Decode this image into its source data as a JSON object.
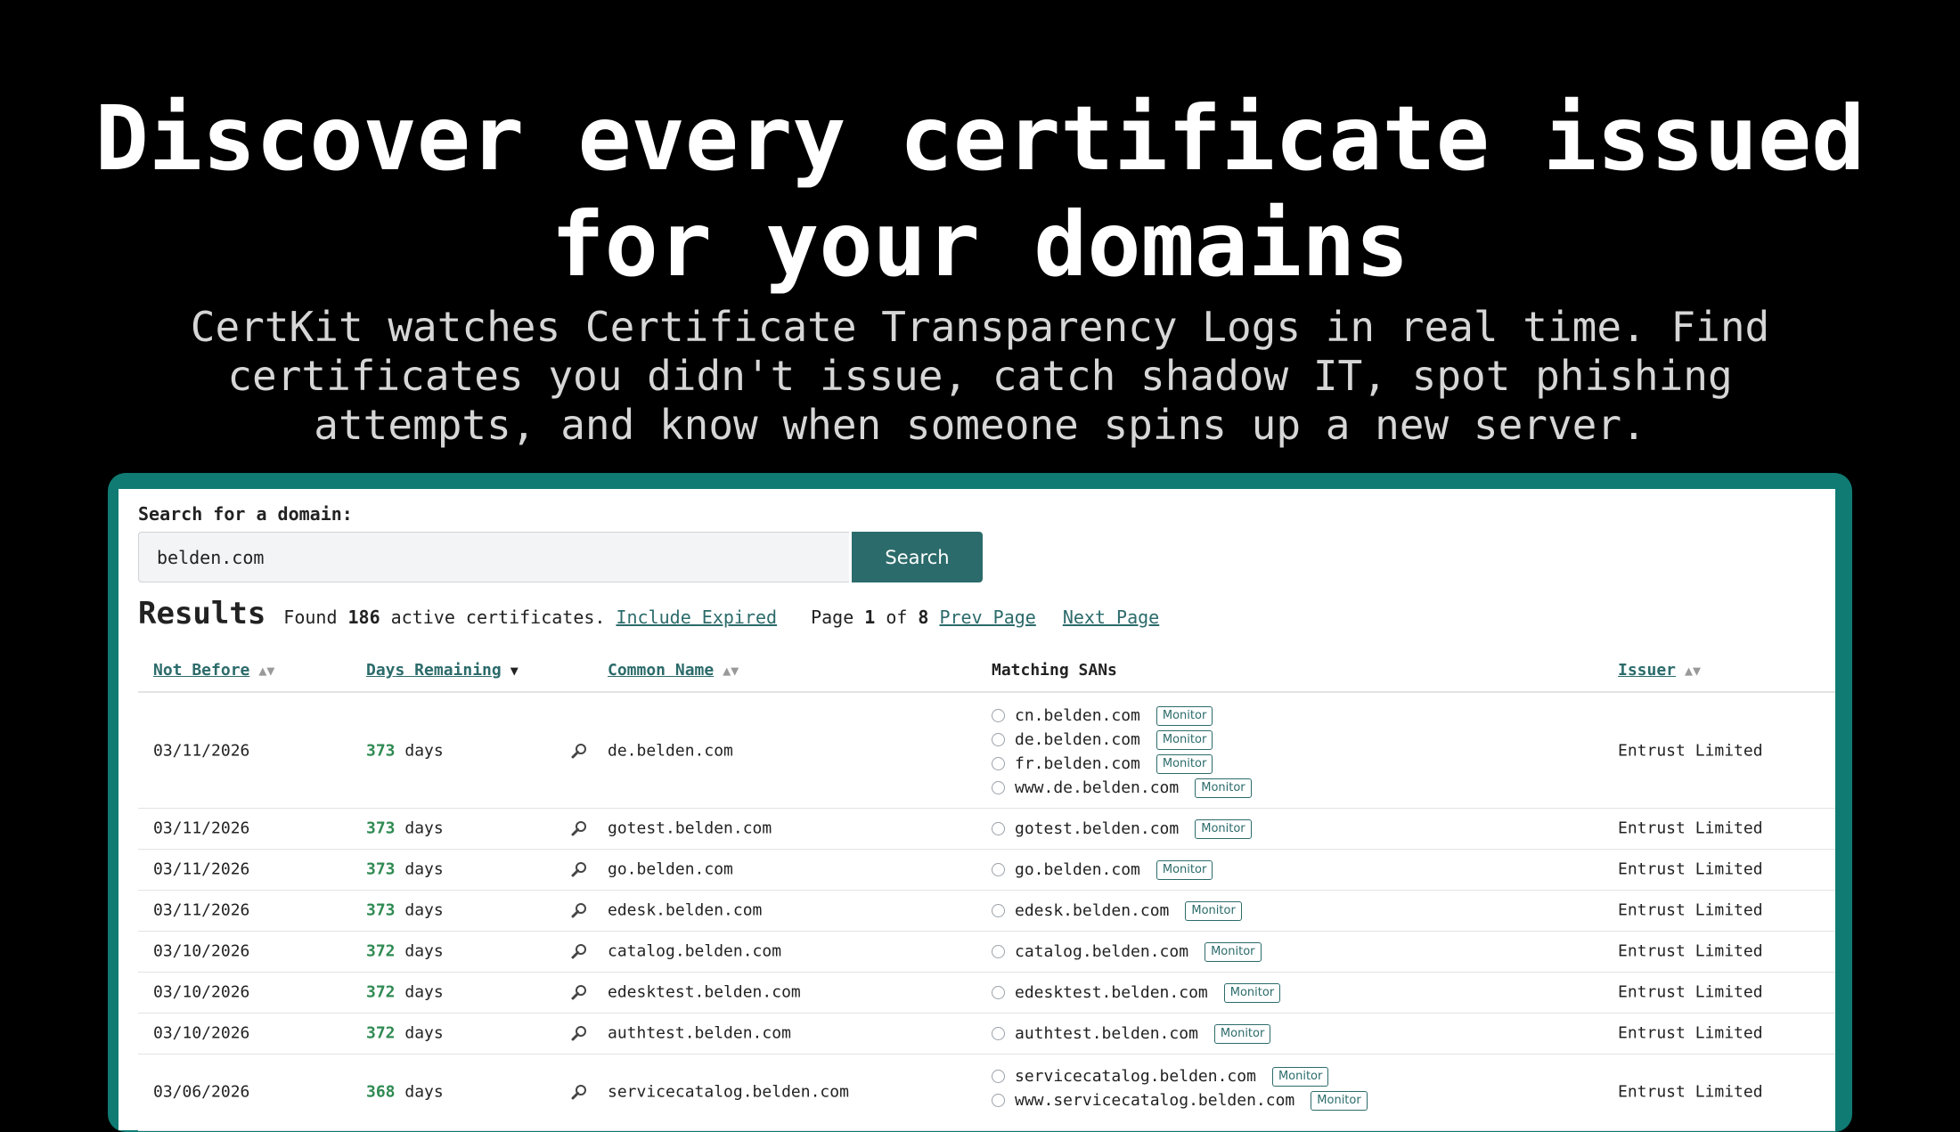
{
  "hero": {
    "title_line1": "Discover every certificate issued",
    "title_line2": "for your domains",
    "sub_line1": "CertKit watches Certificate Transparency Logs in real time. Find",
    "sub_line2": "certificates you didn't issue, catch shadow IT, spot phishing",
    "sub_line3": "attempts, and know when someone spins up a new server."
  },
  "search": {
    "label": "Search for a domain:",
    "value": "belden.com",
    "button": "Search"
  },
  "results": {
    "title": "Results",
    "found_prefix": "Found",
    "count": "186",
    "found_suffix": "active certificates.",
    "include_expired": "Include Expired",
    "page_label": "Page",
    "page": "1",
    "of_label": "of",
    "total_pages": "8",
    "prev": "Prev Page",
    "next": "Next Page"
  },
  "table": {
    "headers": {
      "not_before": "Not Before",
      "days_remaining": "Days Remaining",
      "common_name": "Common Name",
      "matching_sans": "Matching SANs",
      "issuer": "Issuer"
    },
    "sort_arrows": "▲▼",
    "sort_desc": "▼",
    "days_unit": "days",
    "monitor_label": "Monitor",
    "rows": [
      {
        "not_before": "03/11/2026",
        "days": "373",
        "common_name": "de.belden.com",
        "sans": [
          "cn.belden.com",
          "de.belden.com",
          "fr.belden.com",
          "www.de.belden.com"
        ],
        "issuer": "Entrust Limited"
      },
      {
        "not_before": "03/11/2026",
        "days": "373",
        "common_name": "gotest.belden.com",
        "sans": [
          "gotest.belden.com"
        ],
        "issuer": "Entrust Limited"
      },
      {
        "not_before": "03/11/2026",
        "days": "373",
        "common_name": "go.belden.com",
        "sans": [
          "go.belden.com"
        ],
        "issuer": "Entrust Limited"
      },
      {
        "not_before": "03/11/2026",
        "days": "373",
        "common_name": "edesk.belden.com",
        "sans": [
          "edesk.belden.com"
        ],
        "issuer": "Entrust Limited"
      },
      {
        "not_before": "03/10/2026",
        "days": "372",
        "common_name": "catalog.belden.com",
        "sans": [
          "catalog.belden.com"
        ],
        "issuer": "Entrust Limited"
      },
      {
        "not_before": "03/10/2026",
        "days": "372",
        "common_name": "edesktest.belden.com",
        "sans": [
          "edesktest.belden.com"
        ],
        "issuer": "Entrust Limited"
      },
      {
        "not_before": "03/10/2026",
        "days": "372",
        "common_name": "authtest.belden.com",
        "sans": [
          "authtest.belden.com"
        ],
        "issuer": "Entrust Limited"
      },
      {
        "not_before": "03/06/2026",
        "days": "368",
        "common_name": "servicecatalog.belden.com",
        "sans": [
          "servicecatalog.belden.com",
          "www.servicecatalog.belden.com"
        ],
        "issuer": "Entrust Limited"
      }
    ]
  }
}
